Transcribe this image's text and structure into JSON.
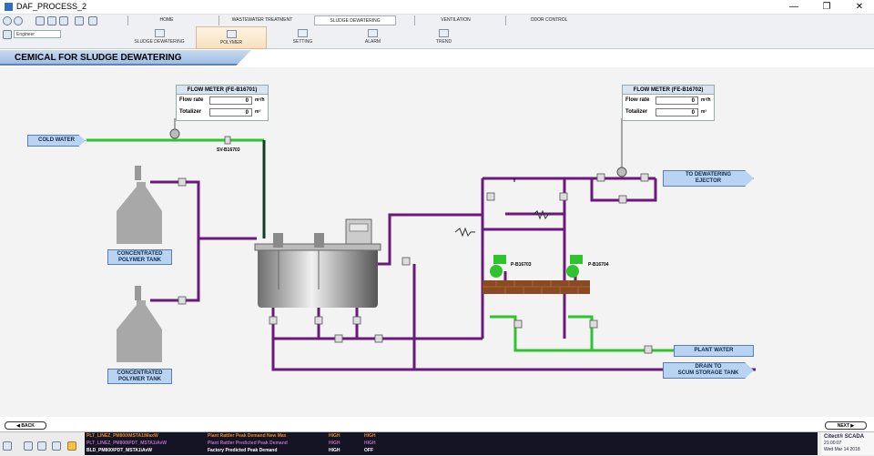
{
  "window": {
    "title": "DAF_PROCESS_2",
    "min": "—",
    "max": "❐",
    "close": "✕"
  },
  "toolbar": {
    "user": "Engineer"
  },
  "nav_top": [
    {
      "label": "HOME"
    },
    {
      "label": "WASTEWATER TREATMENT"
    },
    {
      "label": "SLUDGE DEWATERING"
    },
    {
      "label": "VENTILATION"
    },
    {
      "label": "ODOR CONTROL"
    }
  ],
  "nav_sub": [
    {
      "label": "SLUDGE DEWATERING"
    },
    {
      "label": "POLYMER"
    },
    {
      "label": "SETTING"
    },
    {
      "label": "ALARM"
    },
    {
      "label": "TREND"
    }
  ],
  "page": {
    "title": "CEMICAL FOR SLUDGE DEWATERING"
  },
  "flow_meter_1": {
    "title": "FLOW METER (FE-B16701)",
    "flow_label": "Flow rate",
    "flow_value": "0",
    "flow_unit": "m³/h",
    "tot_label": "Totalizer",
    "tot_value": "0",
    "tot_unit": "m³"
  },
  "flow_meter_2": {
    "title": "FLOW METER (FE-B16702)",
    "flow_label": "Flow rate",
    "flow_value": "0",
    "flow_unit": "m³/h",
    "tot_label": "Totalizer",
    "tot_value": "0",
    "tot_unit": "m³"
  },
  "labels": {
    "cold_water": "COLD WATER",
    "valve_sv": "SV-B16703",
    "tank1_a": "CONCENTRATED",
    "tank1_b": "POLYMER TANK",
    "tank2_a": "CONCENTRATED",
    "tank2_b": "POLYMER TANK",
    "pump1": "P-B16703",
    "pump2": "P-B16704",
    "dewatering_a": "TO DEWATERING",
    "dewatering_b": "EJECTOR",
    "plant_water": "PLANT WATER",
    "drain_a": "DRAIN TO",
    "drain_b": "SCUM STORAGE TANK"
  },
  "buttons": {
    "back": "BACK",
    "next": "NEXT"
  },
  "alarms": [
    {
      "tag": "PLT_LINEZ_PM800\\MSTA1\\MaxW",
      "desc": "Plant Rattler Peak Demand New Max",
      "sev": "HIGH",
      "state": "HIGH",
      "color": "#e58a2c"
    },
    {
      "tag": "PLT_LINEZ_PM800\\PDT_MSTA1\\AvW",
      "desc": "Plant Rattler Predicted Peak Demand",
      "sev": "HIGH",
      "state": "HIGH",
      "color": "#b66cc0"
    },
    {
      "tag": "BLD_PM800\\PDT_MSTA1\\AvW",
      "desc": "Factory Predicted Peak Demand",
      "sev": "HIGH",
      "state": "OFF",
      "color": "#ffffff"
    }
  ],
  "clock": {
    "brand": "Citect® SCADA",
    "time": "21:00:07",
    "date": "Wed Mar 14 2018"
  },
  "colors": {
    "purple_pipe": "#6a1a7a",
    "green_pipe": "#2ec42e",
    "dark_pipe": "#123c2a",
    "tag_blue": "#b8d4f2"
  }
}
